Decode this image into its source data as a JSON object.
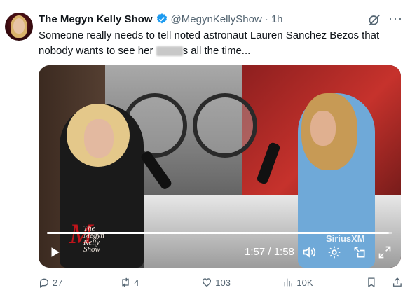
{
  "author": {
    "name": "The Megyn Kelly Show",
    "handle": "@MegynKellyShow",
    "separator": "·",
    "time": "1h"
  },
  "tweet": {
    "text_before": "Someone really needs to tell noted astronaut Lauren Sanchez Bezos that nobody wants to see her ",
    "text_after": "s all the time..."
  },
  "video": {
    "current_time": "1:57",
    "duration": "1:58",
    "time_display": "1:57 / 1:58",
    "progress": 0.99,
    "logo_lines": [
      "The",
      "Megyn",
      "Kelly",
      "Show"
    ],
    "watermark": "SiriusXM"
  },
  "actions": {
    "replies": "27",
    "reposts": "4",
    "likes": "103",
    "views": "10K"
  },
  "icons": [
    "verified-badge-icon",
    "grok-icon",
    "more-icon",
    "play-icon",
    "volume-icon",
    "settings-icon",
    "pip-icon",
    "fullscreen-icon",
    "reply-icon",
    "repost-icon",
    "like-icon",
    "views-icon",
    "bookmark-icon",
    "share-icon"
  ],
  "colors": {
    "verified": "#1d9bf0",
    "secondary_text": "#536471",
    "primary_text": "#0f1419"
  }
}
